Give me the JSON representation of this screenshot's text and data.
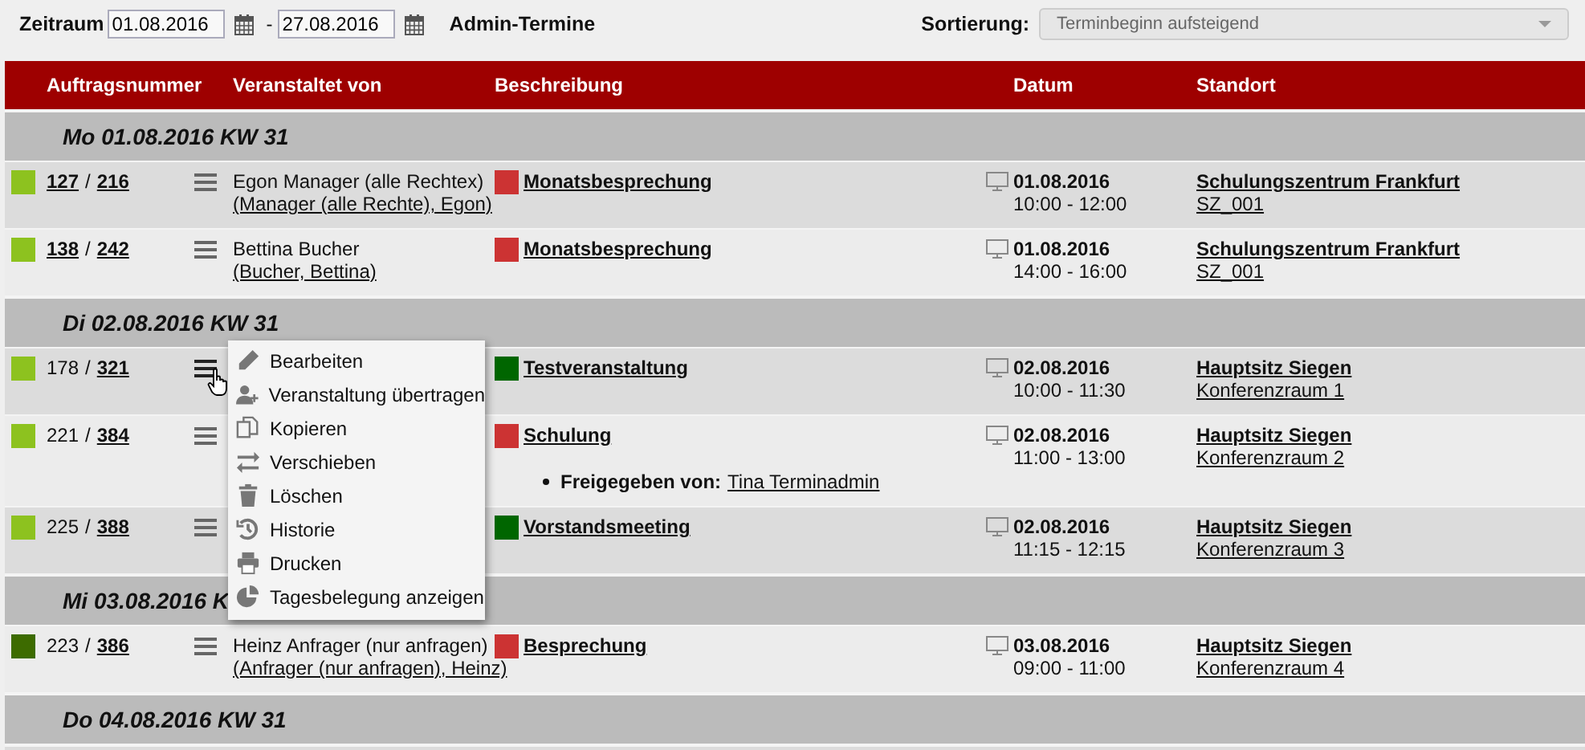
{
  "filter": {
    "label": "Zeitraum",
    "from": "01.08.2016",
    "separator": "-",
    "to": "27.08.2016",
    "title": "Admin-Termine",
    "sort_label": "Sortierung:",
    "sort_value": "Terminbeginn aufsteigend"
  },
  "columns": [
    "Auftragsnummer",
    "Veranstaltet von",
    "Beschreibung",
    "Datum",
    "Standort"
  ],
  "groups": [
    {
      "title": "Mo 01.08.2016 KW 31",
      "rows": [
        {
          "status": {
            "color": "#8dc21f"
          },
          "order": "127",
          "order_link": true,
          "sep": "/",
          "sub": "216",
          "menu_open": false,
          "organizer": "Egon Manager (alle Rechtex)",
          "organizer_link": "(Manager (alle Rechte), Egon)",
          "type": {
            "color": "#cc3333"
          },
          "title": "Monatsbesprechung",
          "date": "01.08.2016",
          "time": "10:00 - 12:00",
          "location": "Schulungszentrum Frankfurt",
          "room": "SZ_001"
        },
        {
          "status": {
            "color": "#8dc21f"
          },
          "order": "138",
          "order_link": true,
          "sep": "/",
          "sub": "242",
          "menu_open": false,
          "organizer": "Bettina Bucher",
          "organizer_link": "(Bucher, Bettina)",
          "type": {
            "color": "#cc3333"
          },
          "title": "Monatsbesprechung",
          "date": "01.08.2016",
          "time": "14:00 - 16:00",
          "location": "Schulungszentrum Frankfurt",
          "room": "SZ_001"
        }
      ]
    },
    {
      "title": "Di 02.08.2016 KW 31",
      "rows": [
        {
          "status": {
            "color": "#8dc21f"
          },
          "order": "178",
          "order_link": false,
          "sep": "/",
          "sub": "321",
          "menu_open": true,
          "type": {
            "color": "#006600"
          },
          "title": "Testveranstaltung",
          "date": "02.08.2016",
          "time": "10:00 - 11:30",
          "location": "Hauptsitz Siegen",
          "room": "Konferenzraum 1"
        },
        {
          "status": {
            "color": "#8dc21f"
          },
          "order": "221",
          "order_link": false,
          "sep": "/",
          "sub": "384",
          "menu_open": false,
          "type": {
            "color": "#cc3333"
          },
          "title": "Schulung",
          "note_label": "Freigegeben von:",
          "note_link": "Tina Terminadmin",
          "date": "02.08.2016",
          "time": "11:00 - 13:00",
          "location": "Hauptsitz Siegen",
          "room": "Konferenzraum 2"
        },
        {
          "status": {
            "color": "#8dc21f"
          },
          "order": "225",
          "order_link": false,
          "sep": "/",
          "sub": "388",
          "menu_open": false,
          "type": {
            "color": "#006600"
          },
          "title": "Vorstandsmeeting",
          "date": "02.08.2016",
          "time": "11:15 - 12:15",
          "location": "Hauptsitz Siegen",
          "room": "Konferenzraum 3"
        }
      ]
    },
    {
      "title": "Mi 03.08.2016 K",
      "rows": [
        {
          "status": {
            "color": "#3d6b00"
          },
          "order": "223",
          "order_link": false,
          "sep": "/",
          "sub": "386",
          "menu_open": false,
          "organizer": "Heinz Anfrager (nur anfragen)",
          "organizer_link": "(Anfrager (nur anfragen), Heinz)",
          "type": {
            "color": "#cc3333"
          },
          "title": "Besprechung",
          "date": "03.08.2016",
          "time": "09:00 - 11:00",
          "location": "Hauptsitz Siegen",
          "room": "Konferenzraum 4"
        }
      ]
    },
    {
      "title": "Do 04.08.2016 KW 31"
    }
  ],
  "context_menu": [
    "Bearbeiten",
    "Veranstaltung übertragen",
    "Kopieren",
    "Verschieben",
    "Löschen",
    "Historie",
    "Drucken",
    "Tagesbelegung anzeigen"
  ]
}
